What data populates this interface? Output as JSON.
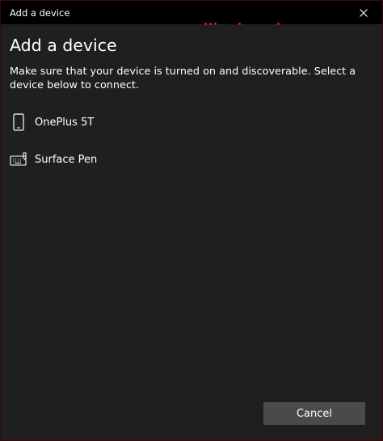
{
  "window": {
    "title": "Add a device",
    "close_icon": "close-icon"
  },
  "dialog": {
    "heading": "Add a device",
    "instructions": "Make sure that your device is turned on and discoverable. Select a device below to connect."
  },
  "devices": [
    {
      "name": "OnePlus 5T",
      "icon": "phone-icon"
    },
    {
      "name": "Surface Pen",
      "icon": "keyboard-pen-icon"
    }
  ],
  "footer": {
    "cancel_label": "Cancel"
  },
  "colors": {
    "background": "#1f1f1f",
    "titlebar": "#000000",
    "accent": "#e81123",
    "button": "#4a4a4a"
  }
}
